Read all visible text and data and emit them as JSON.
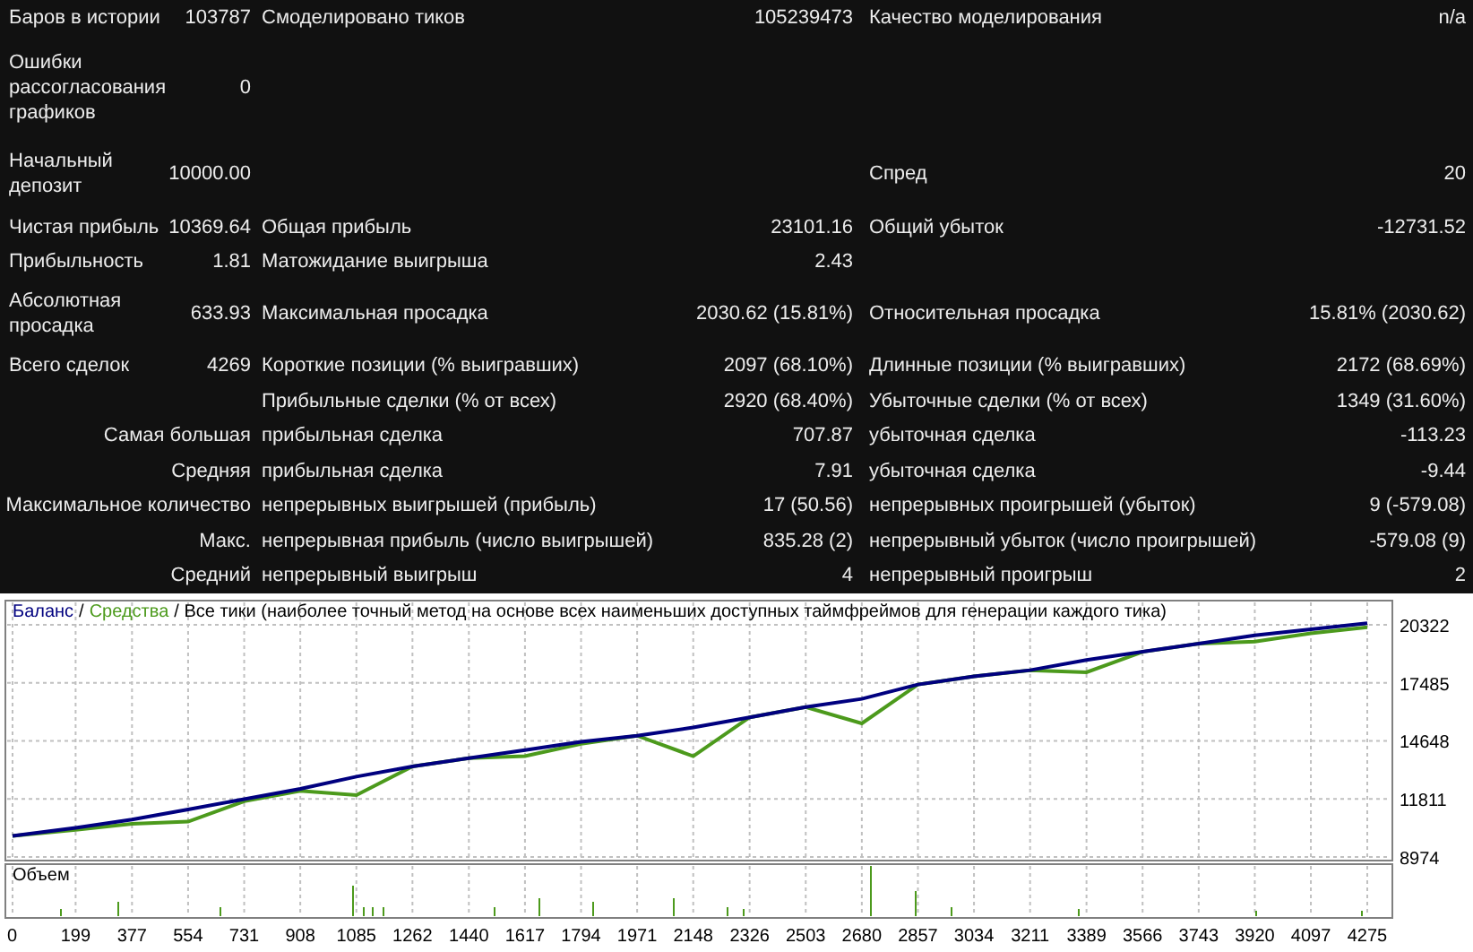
{
  "report": {
    "rows": [
      {
        "kind": "pairs",
        "left": {
          "label": "Баров в истории",
          "value": "103787"
        },
        "middle": {
          "label": "Смоделировано тиков",
          "value": "105239473"
        },
        "right": {
          "label": "Качество моделирования",
          "value": "n/a"
        }
      },
      {
        "kind": "pairs",
        "left": {
          "label": "Ошибки рассогласования графиков",
          "value": "0"
        }
      },
      {
        "kind": "pairs",
        "left": {
          "label": "Начальный депозит",
          "value": "10000.00"
        },
        "right": {
          "label": "Спред",
          "value": "20"
        }
      },
      {
        "kind": "pairs",
        "left": {
          "label": "Чистая прибыль",
          "value": "10369.64"
        },
        "middle": {
          "label": "Общая прибыль",
          "value": "23101.16"
        },
        "right": {
          "label": "Общий убыток",
          "value": "-12731.52"
        }
      },
      {
        "kind": "pairs",
        "left": {
          "label": "Прибыльность",
          "value": "1.81"
        },
        "middle": {
          "label": "Матожидание выигрыша",
          "value": "2.43"
        }
      },
      {
        "kind": "pairs",
        "left": {
          "label": "Абсолютная просадка",
          "value": "633.93"
        },
        "middle": {
          "label": "Максимальная просадка",
          "value": "2030.62 (15.81%)"
        },
        "right": {
          "label": "Относительная просадка",
          "value": "15.81% (2030.62)"
        }
      },
      {
        "kind": "pairs",
        "left": {
          "label": "Всего сделок",
          "value": "4269"
        },
        "middle": {
          "label": "Короткие позиции (% выигравших)",
          "value": "2097 (68.10%)"
        },
        "right": {
          "label": "Длинные позиции (% выигравших)",
          "value": "2172 (68.69%)"
        }
      },
      {
        "kind": "pairs",
        "middle": {
          "label": "Прибыльные сделки (% от всех)",
          "value": "2920 (68.40%)"
        },
        "right": {
          "label": "Убыточные сделки (% от всех)",
          "value": "1349 (31.60%)"
        }
      },
      {
        "kind": "group",
        "group": "Самая большая",
        "middle": {
          "label": "прибыльная сделка",
          "value": "707.87"
        },
        "right": {
          "label": "убыточная сделка",
          "value": "-113.23"
        }
      },
      {
        "kind": "group",
        "group": "Средняя",
        "middle": {
          "label": "прибыльная сделка",
          "value": "7.91"
        },
        "right": {
          "label": "убыточная сделка",
          "value": "-9.44"
        }
      },
      {
        "kind": "group",
        "group": "Максимальное количество",
        "middle": {
          "label": "непрерывных выигрышей (прибыль)",
          "value": "17 (50.56)"
        },
        "right": {
          "label": "непрерывных проигрышей (убыток)",
          "value": "9 (-579.08)"
        }
      },
      {
        "kind": "group",
        "group": "Макс.",
        "middle": {
          "label": "непрерывная прибыль (число выигрышей)",
          "value": "835.28 (2)"
        },
        "right": {
          "label": "непрерывный убыток (число проигрышей)",
          "value": "-579.08 (9)"
        }
      },
      {
        "kind": "group",
        "group": "Средний",
        "middle": {
          "label": "непрерывный выигрыш",
          "value": "4"
        },
        "right": {
          "label": "непрерывный проигрыш",
          "value": "2"
        }
      }
    ]
  },
  "chart": {
    "series_separator": "/",
    "volume_label": "Объем",
    "chart_data": {
      "type": "line",
      "title": "/ Все тики (наиболее точный метод на основе всех наименьших доступных таймфреймов для генерации каждого тика)",
      "x": [
        0,
        199,
        377,
        554,
        731,
        908,
        1085,
        1262,
        1440,
        1617,
        1794,
        1971,
        2148,
        2326,
        2503,
        2680,
        2857,
        3034,
        3211,
        3389,
        3566,
        3743,
        3920,
        4097,
        4275
      ],
      "series": [
        {
          "name": "Средства",
          "color": "#4c9a1c",
          "values": [
            10000,
            10300,
            10600,
            10700,
            11700,
            12200,
            12000,
            13400,
            13800,
            13900,
            14500,
            14900,
            13900,
            15800,
            16300,
            15500,
            17400,
            17800,
            18100,
            18000,
            19000,
            19400,
            19500,
            19900,
            20200
          ]
        },
        {
          "name": "Баланс",
          "color": "#00007f",
          "values": [
            10000,
            10400,
            10800,
            11300,
            11800,
            12300,
            12900,
            13400,
            13800,
            14200,
            14600,
            14900,
            15300,
            15800,
            16300,
            16700,
            17400,
            17800,
            18100,
            18600,
            19000,
            19400,
            19800,
            20100,
            20400
          ]
        }
      ],
      "grid": true,
      "xlim": [
        0,
        4275
      ],
      "ylim": [
        8800,
        21500
      ],
      "xticks": [
        0,
        199,
        377,
        554,
        731,
        908,
        1085,
        1262,
        1440,
        1617,
        1794,
        1971,
        2148,
        2326,
        2503,
        2680,
        2857,
        3034,
        3211,
        3389,
        3566,
        3743,
        3920,
        4097,
        4275
      ],
      "yticks": [
        8974,
        11811,
        14648,
        17485,
        20322
      ]
    }
  }
}
